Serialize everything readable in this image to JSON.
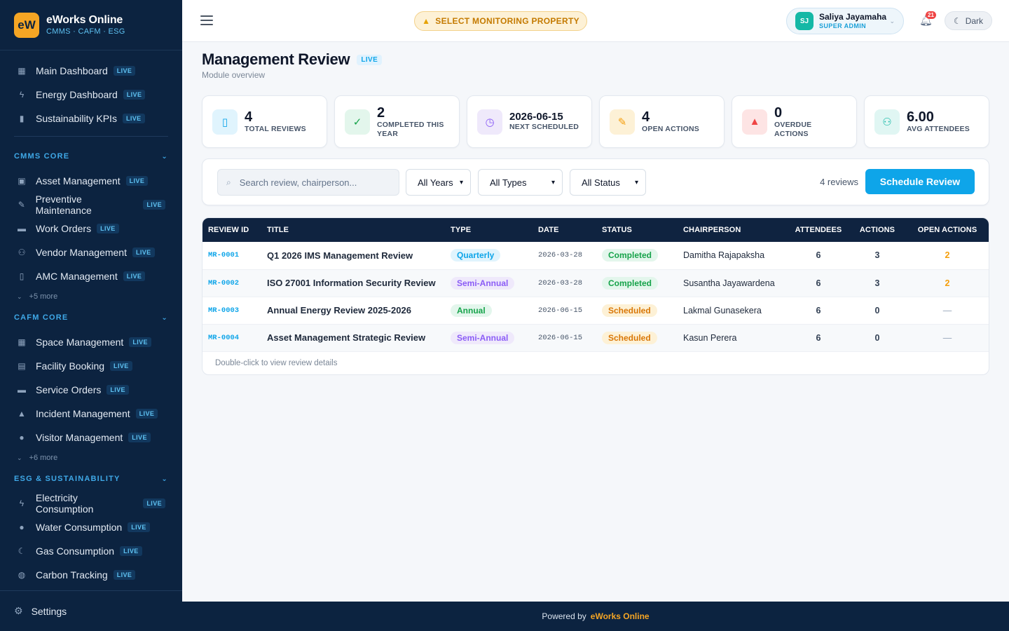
{
  "brand": {
    "logo": "eW",
    "name": "eWorks Online",
    "sub": "CMMS · CAFM · ESG"
  },
  "sidebar": {
    "top_items": [
      {
        "label": "Main Dashboard",
        "badge": "LIVE",
        "icon": "grid-icon"
      },
      {
        "label": "Energy Dashboard",
        "badge": "LIVE",
        "icon": "bolt-icon"
      },
      {
        "label": "Sustainability KPIs",
        "badge": "LIVE",
        "icon": "book-icon"
      }
    ],
    "sections": [
      {
        "title": "CMMS CORE",
        "items": [
          {
            "label": "Asset Management",
            "badge": "LIVE",
            "icon": "asset-icon"
          },
          {
            "label": "Preventive Maintenance",
            "badge": "LIVE",
            "icon": "wrench-icon"
          },
          {
            "label": "Work Orders",
            "badge": "LIVE",
            "icon": "ticket-icon"
          },
          {
            "label": "Vendor Management",
            "badge": "LIVE",
            "icon": "people-icon"
          },
          {
            "label": "AMC Management",
            "badge": "LIVE",
            "icon": "document-icon"
          }
        ],
        "more": "+5 more"
      },
      {
        "title": "CAFM CORE",
        "items": [
          {
            "label": "Space Management",
            "badge": "LIVE",
            "icon": "building-icon"
          },
          {
            "label": "Facility Booking",
            "badge": "LIVE",
            "icon": "calendar-icon"
          },
          {
            "label": "Service Orders",
            "badge": "LIVE",
            "icon": "ticket-icon"
          },
          {
            "label": "Incident Management",
            "badge": "LIVE",
            "icon": "warning-icon"
          },
          {
            "label": "Visitor Management",
            "badge": "LIVE",
            "icon": "person-icon"
          }
        ],
        "more": "+6 more"
      },
      {
        "title": "ESG & SUSTAINABILITY",
        "items": [
          {
            "label": "Electricity Consumption",
            "badge": "LIVE",
            "icon": "bolt-icon"
          },
          {
            "label": "Water Consumption",
            "badge": "LIVE",
            "icon": "drop-icon"
          },
          {
            "label": "Gas Consumption",
            "badge": "LIVE",
            "icon": "moon-icon"
          },
          {
            "label": "Carbon Tracking",
            "badge": "LIVE",
            "icon": "globe-icon"
          }
        ]
      }
    ],
    "settings_label": "Settings"
  },
  "header": {
    "monitor_label": "SELECT MONITORING PROPERTY",
    "user": {
      "initials": "SJ",
      "name": "Saliya Jayamaha",
      "role": "SUPER ADMIN"
    },
    "notifications": "21",
    "theme_label": "Dark"
  },
  "page": {
    "title": "Management Review",
    "badge": "LIVE",
    "subtitle": "Module overview"
  },
  "stats": [
    {
      "value": "4",
      "label": "TOTAL REVIEWS",
      "icon": "document-icon",
      "color": "#0ea5e9",
      "bg": "#e0f4fd"
    },
    {
      "value": "2",
      "label": "COMPLETED THIS YEAR",
      "icon": "check-icon",
      "color": "#16a34a",
      "bg": "#e3f6ec"
    },
    {
      "value": "2026-06-15",
      "label": "NEXT SCHEDULED",
      "icon": "clock-icon",
      "color": "#8b5cf6",
      "bg": "#efe9fb"
    },
    {
      "value": "4",
      "label": "OPEN ACTIONS",
      "icon": "pencil-icon",
      "color": "#f59e0b",
      "bg": "#fdf1d6"
    },
    {
      "value": "0",
      "label": "OVERDUE ACTIONS",
      "icon": "alert-icon",
      "color": "#ef4444",
      "bg": "#fde4e4"
    },
    {
      "value": "6.00",
      "label": "AVG ATTENDEES",
      "icon": "people-icon",
      "color": "#14b8a6",
      "bg": "#e0f6f3"
    }
  ],
  "filters": {
    "search_placeholder": "Search review, chairperson...",
    "years": "All Years",
    "types": "All Types",
    "status": "All Status",
    "count": "4 reviews",
    "schedule_label": "Schedule Review"
  },
  "table": {
    "headers": [
      "REVIEW ID",
      "TITLE",
      "TYPE",
      "DATE",
      "STATUS",
      "CHAIRPERSON",
      "ATTENDEES",
      "ACTIONS",
      "OPEN ACTIONS"
    ],
    "rows": [
      {
        "id": "MR-0001",
        "title": "Q1 2026 IMS Management Review",
        "type": "Quarterly",
        "date": "2026-03-28",
        "status": "Completed",
        "chair": "Damitha Rajapaksha",
        "attendees": "6",
        "actions": "3",
        "open": "2"
      },
      {
        "id": "MR-0002",
        "title": "ISO 27001 Information Security Review",
        "type": "Semi-Annual",
        "date": "2026-03-28",
        "status": "Completed",
        "chair": "Susantha Jayawardena",
        "attendees": "6",
        "actions": "3",
        "open": "2"
      },
      {
        "id": "MR-0003",
        "title": "Annual Energy Review 2025-2026",
        "type": "Annual",
        "date": "2026-06-15",
        "status": "Scheduled",
        "chair": "Lakmal Gunasekera",
        "attendees": "6",
        "actions": "0",
        "open": "—"
      },
      {
        "id": "MR-0004",
        "title": "Asset Management Strategic Review",
        "type": "Semi-Annual",
        "date": "2026-06-15",
        "status": "Scheduled",
        "chair": "Kasun Perera",
        "attendees": "6",
        "actions": "0",
        "open": "—"
      }
    ],
    "footer_hint": "Double-click to view review details"
  },
  "footer": {
    "powered_by": "Powered by",
    "brand": "eWorks Online"
  }
}
